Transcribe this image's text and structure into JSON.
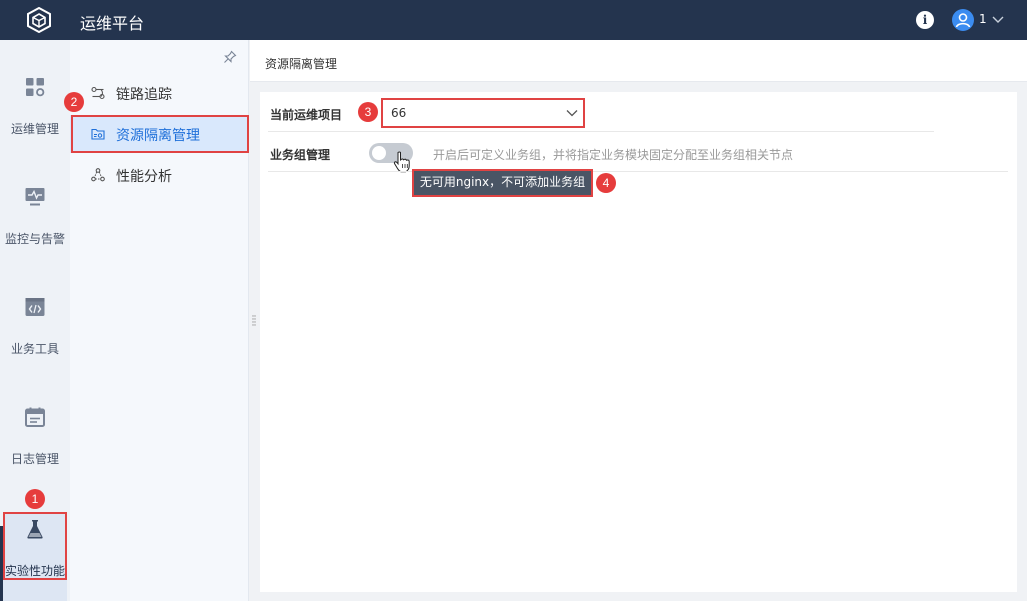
{
  "topbar": {
    "app_title": "运维平台",
    "info_icon": "info-icon",
    "user_name": "1"
  },
  "rail": {
    "items": [
      {
        "label": "运维管理",
        "icon": "dashboard-grid-icon"
      },
      {
        "label": "监控与告警",
        "icon": "monitor-icon"
      },
      {
        "label": "业务工具",
        "icon": "code-window-icon"
      },
      {
        "label": "日志管理",
        "icon": "calendar-log-icon"
      },
      {
        "label": "实验性功能",
        "icon": "flask-icon"
      }
    ]
  },
  "submenu": {
    "items": [
      {
        "label": "链路追踪",
        "icon": "trace-icon"
      },
      {
        "label": "资源隔离管理",
        "icon": "folder-settings-icon"
      },
      {
        "label": "性能分析",
        "icon": "nodes-icon"
      }
    ]
  },
  "main": {
    "title": "资源隔离管理",
    "form": {
      "project_label": "当前运维项目",
      "project_value": "66",
      "group_label": "业务组管理",
      "switch_description": "开启后可定义业务组，并将指定业务模块固定分配至业务组相关节点",
      "switch_on": false,
      "tooltip": "无可用nginx，不可添加业务组"
    }
  },
  "markers": [
    "1",
    "2",
    "3",
    "4"
  ],
  "colors": {
    "topbar": "#24344e",
    "accent": "#1e6fd9",
    "marker": "#e63c3c"
  }
}
